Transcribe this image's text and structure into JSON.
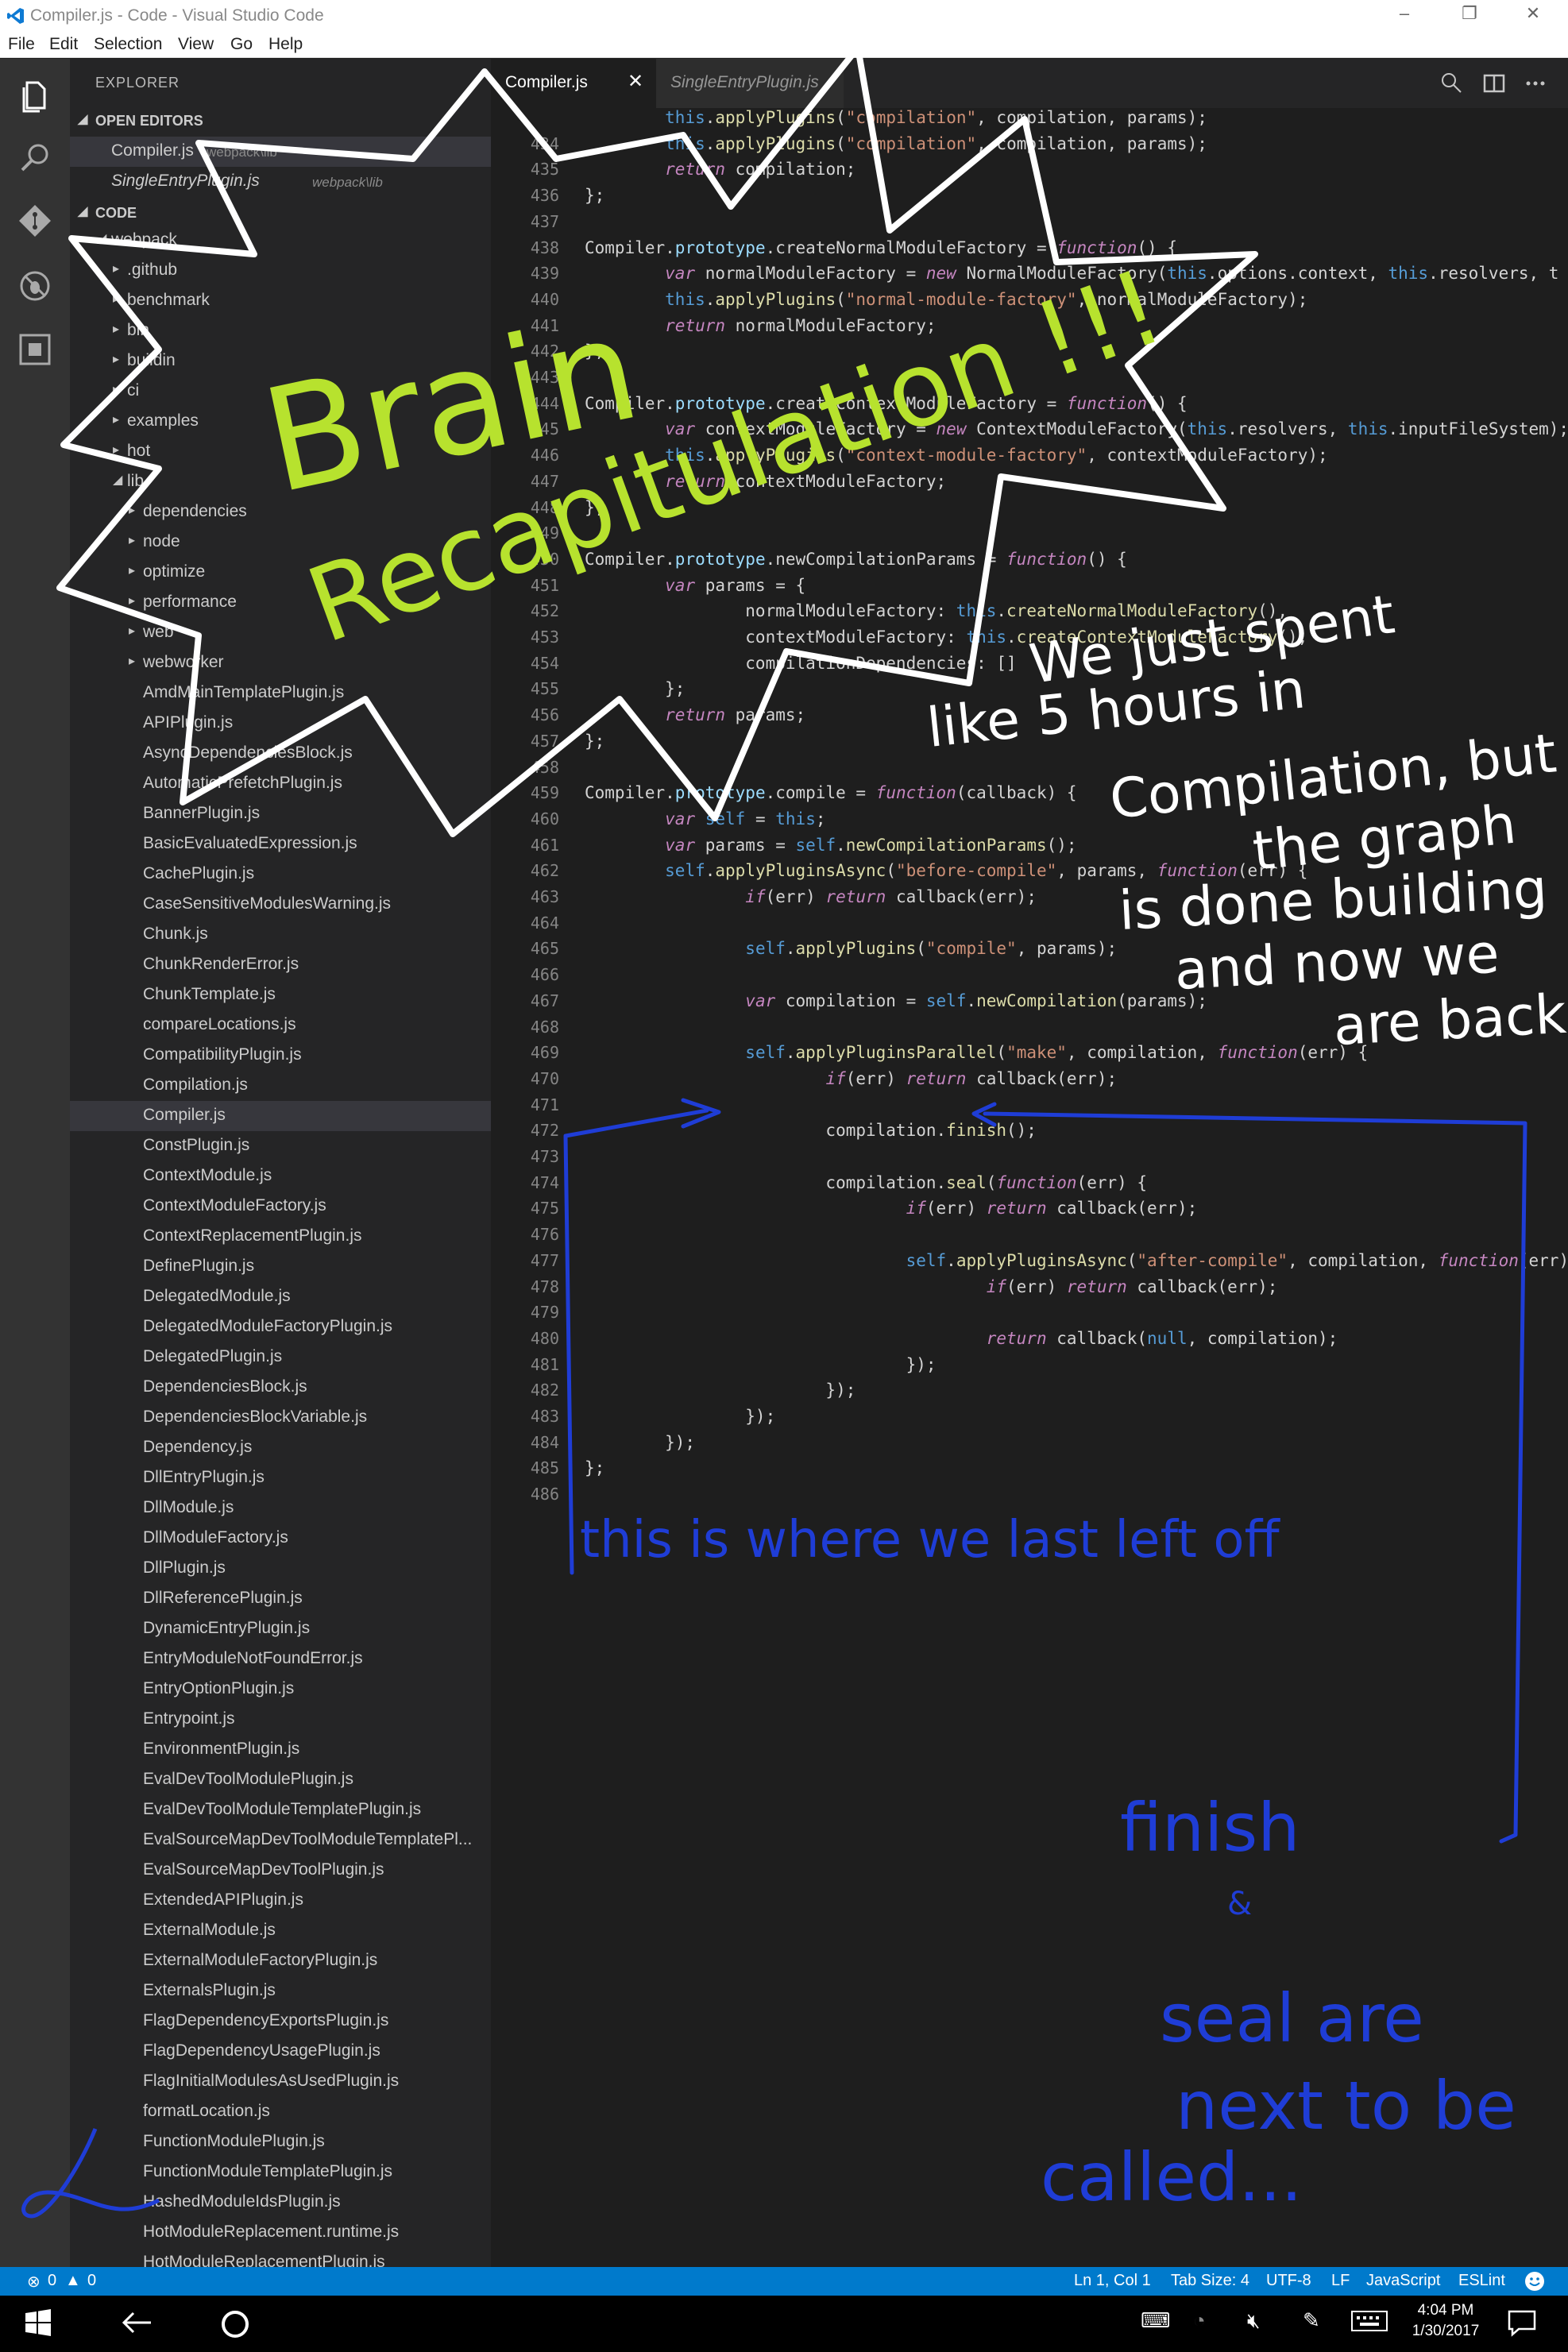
{
  "window": {
    "title": "Compiler.js - Code - Visual Studio Code",
    "controls": [
      "–",
      "❐",
      "✕"
    ]
  },
  "menu": [
    "File",
    "Edit",
    "Selection",
    "View",
    "Go",
    "Help"
  ],
  "activity_icons": [
    "files-icon",
    "search-icon",
    "git-icon",
    "debug-icon",
    "extensions-icon"
  ],
  "sidebar": {
    "header": "EXPLORER",
    "open_editors_label": "OPEN EDITORS",
    "open_editors": [
      {
        "name": "Compiler.js",
        "path": "webpack\\lib"
      },
      {
        "name": "SingleEntryPlugin.js",
        "path": "webpack\\lib"
      }
    ],
    "code_label": "CODE",
    "tree": [
      {
        "label": "webpack",
        "level": 1,
        "type": "open"
      },
      {
        "label": ".github",
        "level": 2,
        "type": "closed"
      },
      {
        "label": "benchmark",
        "level": 2,
        "type": "closed"
      },
      {
        "label": "bin",
        "level": 2,
        "type": "closed"
      },
      {
        "label": "buildin",
        "level": 2,
        "type": "closed"
      },
      {
        "label": "ci",
        "level": 2,
        "type": "closed"
      },
      {
        "label": "examples",
        "level": 2,
        "type": "closed"
      },
      {
        "label": "hot",
        "level": 2,
        "type": "closed"
      },
      {
        "label": "lib",
        "level": 2,
        "type": "open"
      },
      {
        "label": "dependencies",
        "level": 3,
        "type": "closed"
      },
      {
        "label": "node",
        "level": 3,
        "type": "closed"
      },
      {
        "label": "optimize",
        "level": 3,
        "type": "closed"
      },
      {
        "label": "performance",
        "level": 3,
        "type": "closed"
      },
      {
        "label": "web",
        "level": 3,
        "type": "closed"
      },
      {
        "label": "webworker",
        "level": 3,
        "type": "closed"
      },
      {
        "label": "AmdMainTemplatePlugin.js",
        "level": 3,
        "type": "file"
      },
      {
        "label": "APIPlugin.js",
        "level": 3,
        "type": "file"
      },
      {
        "label": "AsyncDependenciesBlock.js",
        "level": 3,
        "type": "file"
      },
      {
        "label": "AutomaticPrefetchPlugin.js",
        "level": 3,
        "type": "file"
      },
      {
        "label": "BannerPlugin.js",
        "level": 3,
        "type": "file"
      },
      {
        "label": "BasicEvaluatedExpression.js",
        "level": 3,
        "type": "file"
      },
      {
        "label": "CachePlugin.js",
        "level": 3,
        "type": "file"
      },
      {
        "label": "CaseSensitiveModulesWarning.js",
        "level": 3,
        "type": "file"
      },
      {
        "label": "Chunk.js",
        "level": 3,
        "type": "file"
      },
      {
        "label": "ChunkRenderError.js",
        "level": 3,
        "type": "file"
      },
      {
        "label": "ChunkTemplate.js",
        "level": 3,
        "type": "file"
      },
      {
        "label": "compareLocations.js",
        "level": 3,
        "type": "file"
      },
      {
        "label": "CompatibilityPlugin.js",
        "level": 3,
        "type": "file"
      },
      {
        "label": "Compilation.js",
        "level": 3,
        "type": "file"
      },
      {
        "label": "Compiler.js",
        "level": 3,
        "type": "file",
        "active": true
      },
      {
        "label": "ConstPlugin.js",
        "level": 3,
        "type": "file"
      },
      {
        "label": "ContextModule.js",
        "level": 3,
        "type": "file"
      },
      {
        "label": "ContextModuleFactory.js",
        "level": 3,
        "type": "file"
      },
      {
        "label": "ContextReplacementPlugin.js",
        "level": 3,
        "type": "file"
      },
      {
        "label": "DefinePlugin.js",
        "level": 3,
        "type": "file"
      },
      {
        "label": "DelegatedModule.js",
        "level": 3,
        "type": "file"
      },
      {
        "label": "DelegatedModuleFactoryPlugin.js",
        "level": 3,
        "type": "file"
      },
      {
        "label": "DelegatedPlugin.js",
        "level": 3,
        "type": "file"
      },
      {
        "label": "DependenciesBlock.js",
        "level": 3,
        "type": "file"
      },
      {
        "label": "DependenciesBlockVariable.js",
        "level": 3,
        "type": "file"
      },
      {
        "label": "Dependency.js",
        "level": 3,
        "type": "file"
      },
      {
        "label": "DllEntryPlugin.js",
        "level": 3,
        "type": "file"
      },
      {
        "label": "DllModule.js",
        "level": 3,
        "type": "file"
      },
      {
        "label": "DllModuleFactory.js",
        "level": 3,
        "type": "file"
      },
      {
        "label": "DllPlugin.js",
        "level": 3,
        "type": "file"
      },
      {
        "label": "DllReferencePlugin.js",
        "level": 3,
        "type": "file"
      },
      {
        "label": "DynamicEntryPlugin.js",
        "level": 3,
        "type": "file"
      },
      {
        "label": "EntryModuleNotFoundError.js",
        "level": 3,
        "type": "file"
      },
      {
        "label": "EntryOptionPlugin.js",
        "level": 3,
        "type": "file"
      },
      {
        "label": "Entrypoint.js",
        "level": 3,
        "type": "file"
      },
      {
        "label": "EnvironmentPlugin.js",
        "level": 3,
        "type": "file"
      },
      {
        "label": "EvalDevToolModulePlugin.js",
        "level": 3,
        "type": "file"
      },
      {
        "label": "EvalDevToolModuleTemplatePlugin.js",
        "level": 3,
        "type": "file"
      },
      {
        "label": "EvalSourceMapDevToolModuleTemplatePl...",
        "level": 3,
        "type": "file"
      },
      {
        "label": "EvalSourceMapDevToolPlugin.js",
        "level": 3,
        "type": "file"
      },
      {
        "label": "ExtendedAPIPlugin.js",
        "level": 3,
        "type": "file"
      },
      {
        "label": "ExternalModule.js",
        "level": 3,
        "type": "file"
      },
      {
        "label": "ExternalModuleFactoryPlugin.js",
        "level": 3,
        "type": "file"
      },
      {
        "label": "ExternalsPlugin.js",
        "level": 3,
        "type": "file"
      },
      {
        "label": "FlagDependencyExportsPlugin.js",
        "level": 3,
        "type": "file"
      },
      {
        "label": "FlagDependencyUsagePlugin.js",
        "level": 3,
        "type": "file"
      },
      {
        "label": "FlagInitialModulesAsUsedPlugin.js",
        "level": 3,
        "type": "file"
      },
      {
        "label": "formatLocation.js",
        "level": 3,
        "type": "file"
      },
      {
        "label": "FunctionModulePlugin.js",
        "level": 3,
        "type": "file"
      },
      {
        "label": "FunctionModuleTemplatePlugin.js",
        "level": 3,
        "type": "file"
      },
      {
        "label": "HashedModuleIdsPlugin.js",
        "level": 3,
        "type": "file"
      },
      {
        "label": "HotModuleReplacement.runtime.js",
        "level": 3,
        "type": "file"
      },
      {
        "label": "HotModuleReplacementPlugin.js",
        "level": 3,
        "type": "file"
      }
    ]
  },
  "tabs": [
    {
      "label": "Compiler.js",
      "active": true,
      "close": "✕"
    },
    {
      "label": "SingleEntryPlugin.js",
      "active": false
    }
  ],
  "editor_actions": [
    "open-changes-icon",
    "split-editor-icon",
    "more-actions-icon"
  ],
  "code": [
    {
      "n": "",
      "t": "        this.applyPlugins(\"compilation\", compilation, params);"
    },
    {
      "n": "434",
      "t": "        this.applyPlugins(\"compilation\", compilation, params);"
    },
    {
      "n": "435",
      "t": "        return compilation;"
    },
    {
      "n": "436",
      "t": "};"
    },
    {
      "n": "437",
      "t": ""
    },
    {
      "n": "438",
      "t": "Compiler.prototype.createNormalModuleFactory = function() {"
    },
    {
      "n": "439",
      "t": "        var normalModuleFactory = new NormalModuleFactory(this.options.context, this.resolvers, t"
    },
    {
      "n": "440",
      "t": "        this.applyPlugins(\"normal-module-factory\", normalModuleFactory);"
    },
    {
      "n": "441",
      "t": "        return normalModuleFactory;"
    },
    {
      "n": "442",
      "t": "};"
    },
    {
      "n": "443",
      "t": ""
    },
    {
      "n": "444",
      "t": "Compiler.prototype.createContextModuleFactory = function() {"
    },
    {
      "n": "445",
      "t": "        var contextModuleFactory = new ContextModuleFactory(this.resolvers, this.inputFileSystem);"
    },
    {
      "n": "446",
      "t": "        this.applyPlugins(\"context-module-factory\", contextModuleFactory);"
    },
    {
      "n": "447",
      "t": "        return contextModuleFactory;"
    },
    {
      "n": "448",
      "t": "};"
    },
    {
      "n": "449",
      "t": ""
    },
    {
      "n": "450",
      "t": "Compiler.prototype.newCompilationParams = function() {"
    },
    {
      "n": "451",
      "t": "        var params = {"
    },
    {
      "n": "452",
      "t": "                normalModuleFactory: this.createNormalModuleFactory(),"
    },
    {
      "n": "453",
      "t": "                contextModuleFactory: this.createContextModuleFactory(),"
    },
    {
      "n": "454",
      "t": "                compilationDependencies: []"
    },
    {
      "n": "455",
      "t": "        };"
    },
    {
      "n": "456",
      "t": "        return params;"
    },
    {
      "n": "457",
      "t": "};"
    },
    {
      "n": "458",
      "t": ""
    },
    {
      "n": "459",
      "t": "Compiler.prototype.compile = function(callback) {"
    },
    {
      "n": "460",
      "t": "        var self = this;"
    },
    {
      "n": "461",
      "t": "        var params = self.newCompilationParams();"
    },
    {
      "n": "462",
      "t": "        self.applyPluginsAsync(\"before-compile\", params, function(err) {"
    },
    {
      "n": "463",
      "t": "                if(err) return callback(err);"
    },
    {
      "n": "464",
      "t": ""
    },
    {
      "n": "465",
      "t": "                self.applyPlugins(\"compile\", params);"
    },
    {
      "n": "466",
      "t": ""
    },
    {
      "n": "467",
      "t": "                var compilation = self.newCompilation(params);"
    },
    {
      "n": "468",
      "t": ""
    },
    {
      "n": "469",
      "t": "                self.applyPluginsParallel(\"make\", compilation, function(err) {"
    },
    {
      "n": "470",
      "t": "                        if(err) return callback(err);"
    },
    {
      "n": "471",
      "t": ""
    },
    {
      "n": "472",
      "t": "                        compilation.finish();"
    },
    {
      "n": "473",
      "t": ""
    },
    {
      "n": "474",
      "t": "                        compilation.seal(function(err) {"
    },
    {
      "n": "475",
      "t": "                                if(err) return callback(err);"
    },
    {
      "n": "476",
      "t": ""
    },
    {
      "n": "477",
      "t": "                                self.applyPluginsAsync(\"after-compile\", compilation, function(err) {"
    },
    {
      "n": "478",
      "t": "                                        if(err) return callback(err);"
    },
    {
      "n": "479",
      "t": ""
    },
    {
      "n": "480",
      "t": "                                        return callback(null, compilation);"
    },
    {
      "n": "481",
      "t": "                                });"
    },
    {
      "n": "482",
      "t": "                        });"
    },
    {
      "n": "483",
      "t": "                });"
    },
    {
      "n": "484",
      "t": "        });"
    },
    {
      "n": "485",
      "t": "};"
    },
    {
      "n": "486",
      "t": ""
    }
  ],
  "status": {
    "errors": "0",
    "warnings": "0",
    "position": "Ln 1, Col 1",
    "tab_size": "Tab Size: 4",
    "encoding": "UTF-8",
    "eol": "LF",
    "language": "JavaScript",
    "linter": "ESLint"
  },
  "taskbar": {
    "time": "4:04 PM",
    "date": "1/30/2017"
  },
  "annotations": {
    "brain": "Brain",
    "recap": "Recapitulation !!!",
    "note_lines": [
      "We just spent",
      "like 5 hours in",
      "Compilation, but",
      "the graph",
      "is done building",
      "and now we",
      "are back!"
    ],
    "left_off": "this is where we last left off",
    "finish": "finish",
    "amp": "&",
    "seal_lines": [
      "seal are",
      "next to be",
      "called..."
    ]
  },
  "colors": {
    "accent": "#007acc",
    "green_ink": "#b7e22e",
    "blue_ink": "#1f3dd6",
    "white_ink": "#ffffff"
  }
}
